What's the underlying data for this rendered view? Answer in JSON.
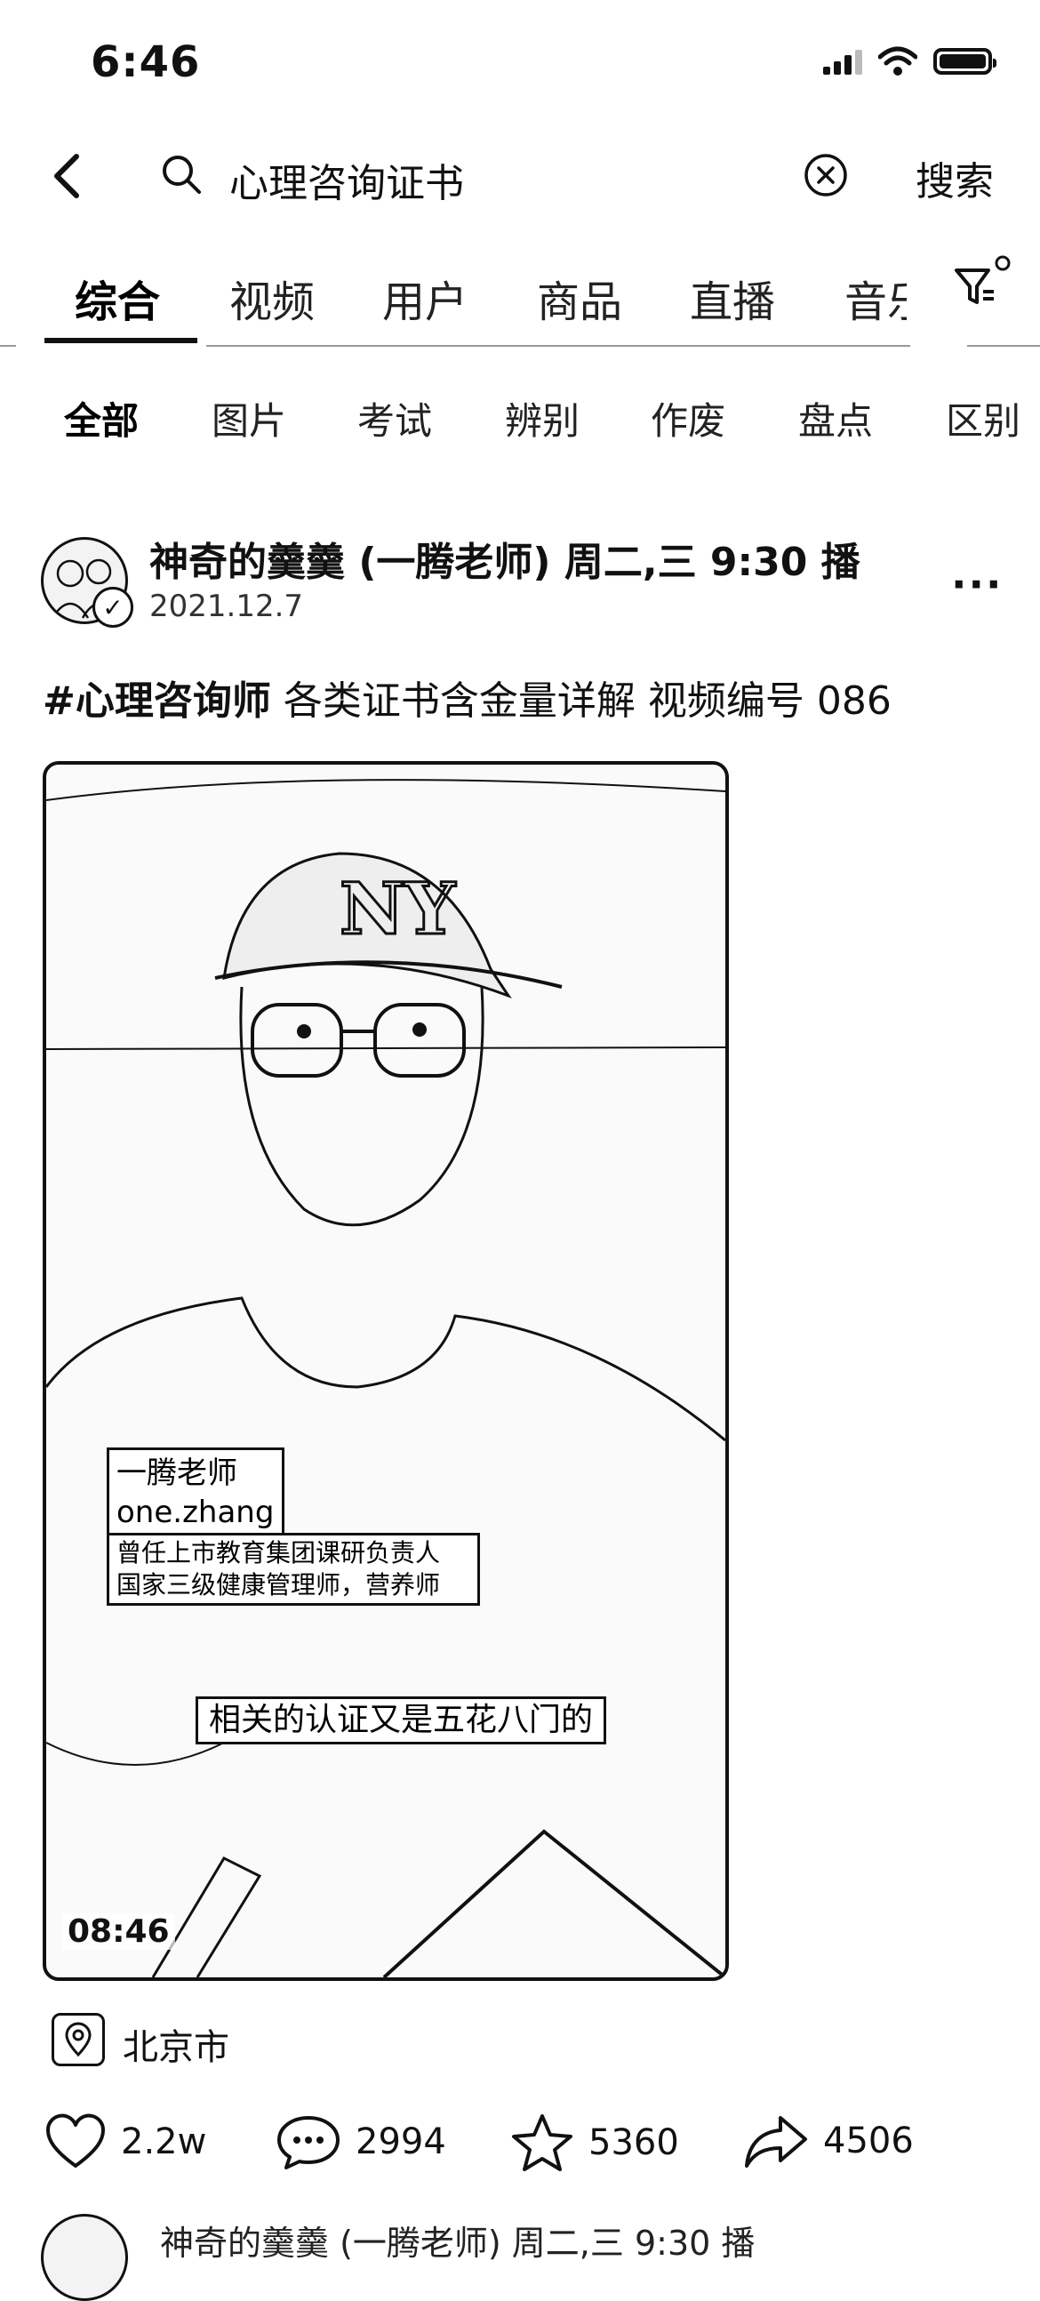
{
  "status_bar": {
    "time": "6:46"
  },
  "search": {
    "query": "心理咨询证书",
    "submit_label": "搜索"
  },
  "tabs": [
    {
      "label": "综合",
      "active": true
    },
    {
      "label": "视频"
    },
    {
      "label": "用户"
    },
    {
      "label": "商品"
    },
    {
      "label": "直播"
    },
    {
      "label": "音乐"
    }
  ],
  "subtabs": [
    {
      "label": "全部",
      "active": true
    },
    {
      "label": "图片"
    },
    {
      "label": "考试"
    },
    {
      "label": "辨别"
    },
    {
      "label": "作废"
    },
    {
      "label": "盘点"
    },
    {
      "label": "区别"
    }
  ],
  "post": {
    "author": "神奇的羹羹 (一腾老师) 周二,三 9:30 播",
    "date": "2021.12.7",
    "caption_tag": "#心理咨询师",
    "caption_rest": " 各类证书含金量详解 视频编号 086",
    "video": {
      "name_line1": "一腾老师",
      "name_line2": "one.zhang",
      "desc_line1": "曾任上市教育集团课研负责人",
      "desc_line2": "国家三级健康管理师，营养师",
      "subtitle": "相关的认证又是五花八门的",
      "duration": "08:46"
    },
    "location": "北京市",
    "likes": "2.2w",
    "comments": "2994",
    "favorites": "5360",
    "shares": "4506"
  },
  "next_post": {
    "author": "神奇的羹羹 (一腾老师) 周二,三 9:30 播"
  },
  "icons": [
    "back-icon",
    "search-icon",
    "clear-icon",
    "filter-icon",
    "more-icon",
    "location-icon",
    "heart-icon",
    "comment-icon",
    "star-icon",
    "share-icon"
  ]
}
